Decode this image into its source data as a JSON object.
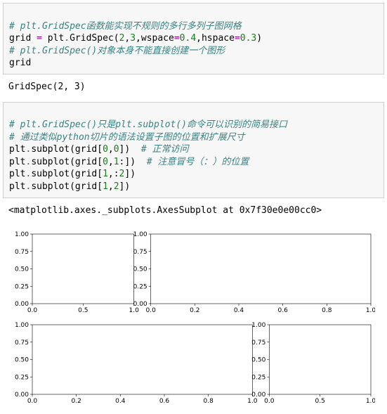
{
  "code1": {
    "l1": "# plt.GridSpec函数能实现不规则的多行多列子图网格",
    "l2a": "grid ",
    "l2op": "=",
    "l2b": " plt",
    "l2c": ".",
    "l2d": "GridSpec(",
    "l2n1": "2",
    "l2e": ",",
    "l2n2": "3",
    "l2f": ",wspace",
    "l2eq1": "=",
    "l2n3": "0.4",
    "l2g": ",hspace",
    "l2eq2": "=",
    "l2n4": "0.3",
    "l2h": ")",
    "l3": "# plt.GridSpec()对象本身不能直接创建一个图形",
    "l4": "grid"
  },
  "out1": "GridSpec(2, 3)",
  "code2": {
    "l1": "# plt.GridSpec()只是plt.subplot()命令可以识别的简易接口",
    "l2": "# 通过类似python切片的语法设置子图的位置和扩展尺寸",
    "l3a": "plt",
    "l3b": ".",
    "l3c": "subplot(grid[",
    "l3n1": "0",
    "l3d": ",",
    "l3n2": "0",
    "l3e": "])  ",
    "l3cm": "# 正常访问",
    "l4a": "plt",
    "l4b": ".",
    "l4c": "subplot(grid[",
    "l4n1": "0",
    "l4d": ",",
    "l4n2": "1",
    "l4e": ":])  ",
    "l4cm": "# 注意冒号（：）的位置",
    "l5a": "plt",
    "l5b": ".",
    "l5c": "subplot(grid[",
    "l5n1": "1",
    "l5d": ",:",
    "l5n2": "2",
    "l5e": "])",
    "l6a": "plt",
    "l6b": ".",
    "l6c": "subplot(grid[",
    "l6n1": "1",
    "l6d": ",",
    "l6n2": "2",
    "l6e": "])"
  },
  "out2": "<matplotlib.axes._subplots.AxesSubplot at 0x7f30e0e00cc0>",
  "chart_data": [
    {
      "type": "line",
      "title": "",
      "xlabel": "",
      "ylabel": "",
      "x": [],
      "y": [],
      "xlim": [
        0.0,
        1.0
      ],
      "ylim": [
        0.0,
        1.0
      ],
      "xticks": [
        0.0,
        0.5,
        1.0
      ],
      "yticks": [
        0.0,
        0.25,
        0.5,
        0.75,
        1.0
      ],
      "position": "row0-col0"
    },
    {
      "type": "line",
      "title": "",
      "xlabel": "",
      "ylabel": "",
      "x": [],
      "y": [],
      "xlim": [
        0.0,
        1.0
      ],
      "ylim": [
        0.0,
        1.0
      ],
      "xticks": [
        0.0,
        0.2,
        0.4,
        0.6,
        0.8,
        1.0
      ],
      "yticks": [
        0.0,
        0.25,
        0.5,
        0.75,
        1.0
      ],
      "position": "row0-col1to2"
    },
    {
      "type": "line",
      "title": "",
      "xlabel": "",
      "ylabel": "",
      "x": [],
      "y": [],
      "xlim": [
        0.0,
        1.0
      ],
      "ylim": [
        0.0,
        1.0
      ],
      "xticks": [
        0.0,
        0.2,
        0.4,
        0.6,
        0.8,
        1.0
      ],
      "yticks": [
        0.0,
        0.25,
        0.5,
        0.75,
        1.0
      ],
      "position": "row1-col0to1"
    },
    {
      "type": "line",
      "title": "",
      "xlabel": "",
      "ylabel": "",
      "x": [],
      "y": [],
      "xlim": [
        0.0,
        1.0
      ],
      "ylim": [
        0.0,
        1.0
      ],
      "xticks": [
        0.0,
        0.5,
        1.0
      ],
      "yticks": [
        0.0,
        0.25,
        0.5,
        0.75,
        1.0
      ],
      "position": "row1-col2"
    }
  ]
}
